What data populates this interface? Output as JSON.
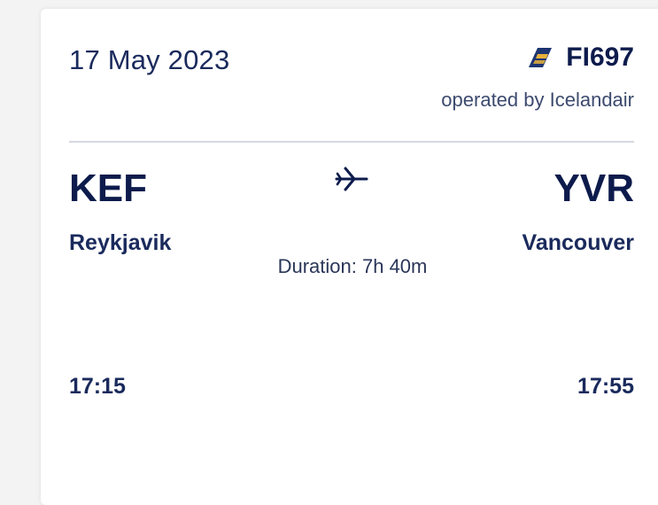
{
  "flight": {
    "date": "17 May 2023",
    "number": "FI697",
    "operator": "operated by Icelandair",
    "duration": "Duration: 7h 40m"
  },
  "origin": {
    "code": "KEF",
    "city": "Reykjavik",
    "time": "17:15"
  },
  "destination": {
    "code": "YVR",
    "city": "Vancouver",
    "time": "17:55"
  },
  "icons": {
    "airline_logo": "icelandair-logo-icon",
    "plane": "airplane-icon"
  },
  "colors": {
    "text_primary": "#0d1b4c",
    "logo_blue": "#1d3570",
    "logo_gold": "#e8b23a",
    "divider": "#d6d9e0"
  }
}
